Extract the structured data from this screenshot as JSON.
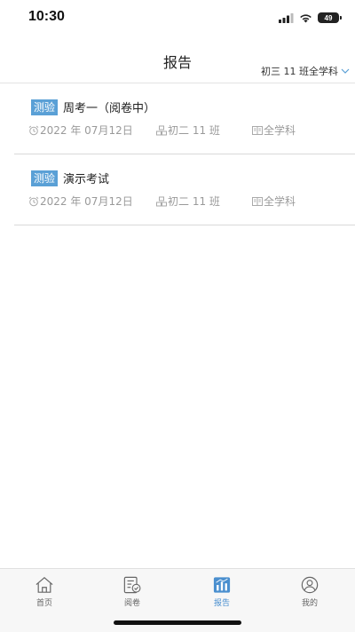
{
  "status_bar": {
    "time": "10:30",
    "battery": "49"
  },
  "header": {
    "title": "报告",
    "class_filter": "初三 11 班全学科"
  },
  "reports": [
    {
      "type": "测验",
      "name": "周考一（阅卷中）",
      "date": "2022 年 07月12日",
      "class": "初二 11 班",
      "subject": "全学科"
    },
    {
      "type": "测验",
      "name": "演示考试",
      "date": "2022 年 07月12日",
      "class": "初二 11 班",
      "subject": "全学科"
    }
  ],
  "tabs": [
    {
      "label": "首页",
      "icon": "home-icon",
      "active": false
    },
    {
      "label": "阅卷",
      "icon": "grading-icon",
      "active": false
    },
    {
      "label": "报告",
      "icon": "report-chart-icon",
      "active": true
    },
    {
      "label": "我的",
      "icon": "user-icon",
      "active": false
    }
  ],
  "colors": {
    "accent": "#4a8fcf",
    "badge": "#5aa0d6",
    "meta_text": "#9a9a9a"
  }
}
